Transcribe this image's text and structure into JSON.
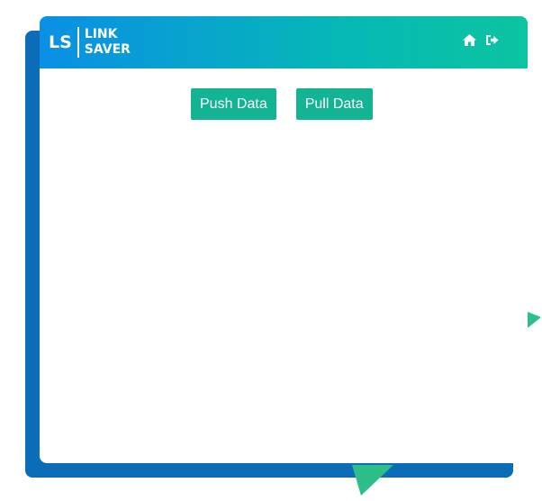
{
  "brand": {
    "mark": "LS",
    "line1": "LINK",
    "line2": "SAVER"
  },
  "header": {
    "icons": [
      "home-icon",
      "sign-out-icon"
    ]
  },
  "actions": {
    "push_label": "Push Data",
    "pull_label": "Pull Data"
  },
  "colors": {
    "brand_blue": "#0b6db7",
    "header_gradient_start": "#0a8fe6",
    "header_gradient_end": "#0bc4a0",
    "button_green": "#12b493",
    "triangle_green": "#2dbf8a"
  }
}
